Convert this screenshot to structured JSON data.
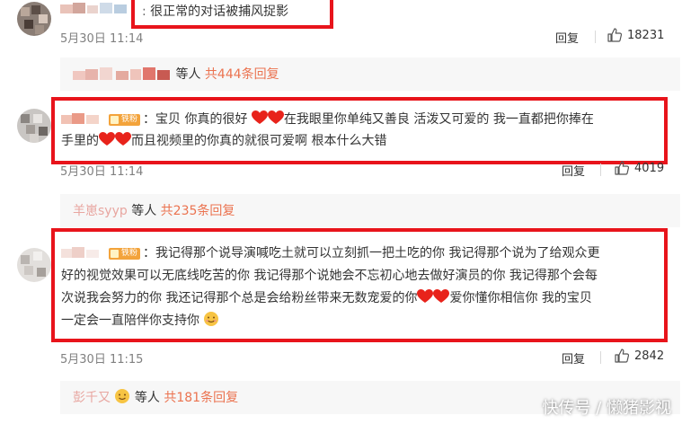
{
  "comments": [
    {
      "text": "很正常的对话被捕风捉影",
      "time": "5月30日 11:14",
      "reply_label": "回复",
      "likes": "18231",
      "reply_summary": {
        "suffix": "等人",
        "count": "共444条回复"
      }
    },
    {
      "badge": "铁粉",
      "text_a": "：宝贝 你真的很好",
      "text_b": "在我眼里你单纯又善良 活泼又可爱的 我一直都把你捧在",
      "text_c": "手里的",
      "text_d": "而且视频里的你真的就很可爱啊 根本什么大错",
      "time": "5月30日 11:14",
      "reply_label": "回复",
      "likes": "4019",
      "reply_summary": {
        "who": "羊崽syyp",
        "suffix": "等人",
        "count": "共235条回复"
      }
    },
    {
      "badge": "铁粉",
      "line1": "：我记得那个说导演喊吃土就可以立刻抓一把土吃的你 我记得那个说为了给观众更",
      "line2": "好的视觉效果可以无底线吃苦的你 我记得那个说她会不忘初心地去做好演员的你 我记得那个会每",
      "line3_a": "次说我会努力的你 我还记得那个总是会给粉丝带来无数宠爱的你",
      "line3_b": "爱你懂你相信你 我的宝贝",
      "line4": "一定会一直陪伴你支持你",
      "time": "5月30日 11:15",
      "reply_label": "回复",
      "likes": "2842",
      "reply_summary": {
        "who": "彭千又",
        "suffix": "等人",
        "count": "共181条回复"
      }
    }
  ],
  "watermark": "快传号 / 懒猪影视",
  "colors": {
    "highlight_box": "#e8141b",
    "reply_count": "#eb7350",
    "username": "#e8a6a0"
  },
  "icons": {
    "like": "thumbs-up-icon",
    "heart": "red-heart-icon",
    "emoji": "smiling-emoji-icon"
  }
}
